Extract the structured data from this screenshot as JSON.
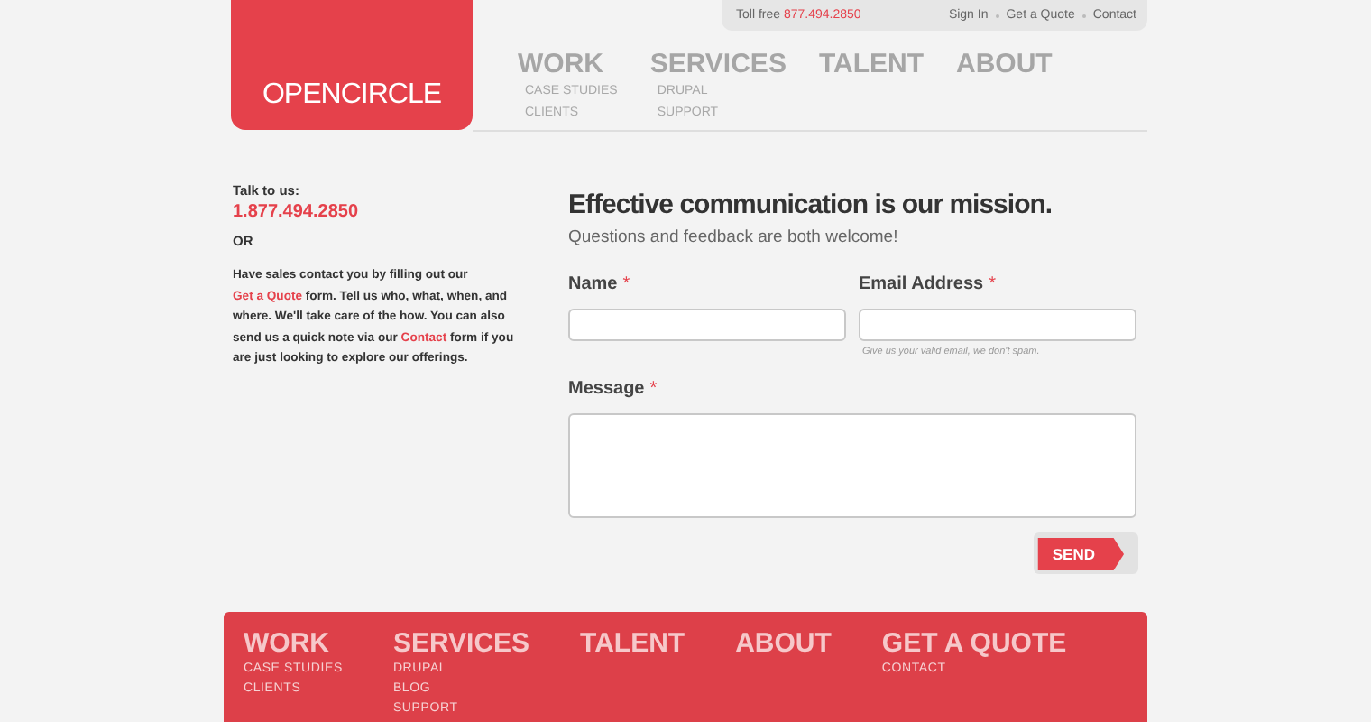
{
  "top_bar": {
    "toll_free_label": "Toll free",
    "toll_free_number": "877.494.2850",
    "links": [
      "Sign In",
      "Get a Quote",
      "Contact"
    ]
  },
  "logo": {
    "text": "OPENCIRCLE"
  },
  "nav": [
    {
      "label": "WORK",
      "children": [
        "CASE STUDIES",
        "CLIENTS"
      ]
    },
    {
      "label": "SERVICES",
      "children": [
        "DRUPAL",
        "SUPPORT"
      ]
    },
    {
      "label": "TALENT"
    },
    {
      "label": "ABOUT"
    }
  ],
  "sidebar": {
    "talk_label": "Talk to us:",
    "phone": "1.877.494.2850",
    "or": "OR",
    "paragraph": [
      {
        "kind": "text",
        "text": "Have sales contact you by filling out our "
      },
      {
        "kind": "link",
        "text": "Get a Quote"
      },
      {
        "kind": "text",
        "text": " form. Tell us who, what, when, and where. We'll take care of the how. You can also send us a quick note via our "
      },
      {
        "kind": "link",
        "text": "Contact"
      },
      {
        "kind": "text",
        "text": " form if you are just looking to explore our offerings."
      }
    ]
  },
  "form": {
    "title": "Effective communication is our mission.",
    "subtitle": "Questions and feedback are both welcome!",
    "fields": [
      {
        "kind": "input",
        "label": "Name",
        "required_mark": "*"
      },
      {
        "kind": "input",
        "label": "Email Address",
        "required_mark": "*",
        "hint": "Give us your valid email, we don't spam."
      },
      {
        "kind": "textarea",
        "label": "Message",
        "required_mark": "*"
      }
    ],
    "submit": "SEND"
  },
  "footer": {
    "columns": [
      {
        "label": "WORK",
        "children": [
          "CASE STUDIES",
          "CLIENTS"
        ]
      },
      {
        "label": "SERVICES",
        "children": [
          "DRUPAL",
          "BLOG",
          "SUPPORT"
        ]
      },
      {
        "label": "TALENT"
      },
      {
        "label": "ABOUT"
      },
      {
        "label": "GET A QUOTE",
        "children": [
          "CONTACT"
        ]
      }
    ]
  }
}
